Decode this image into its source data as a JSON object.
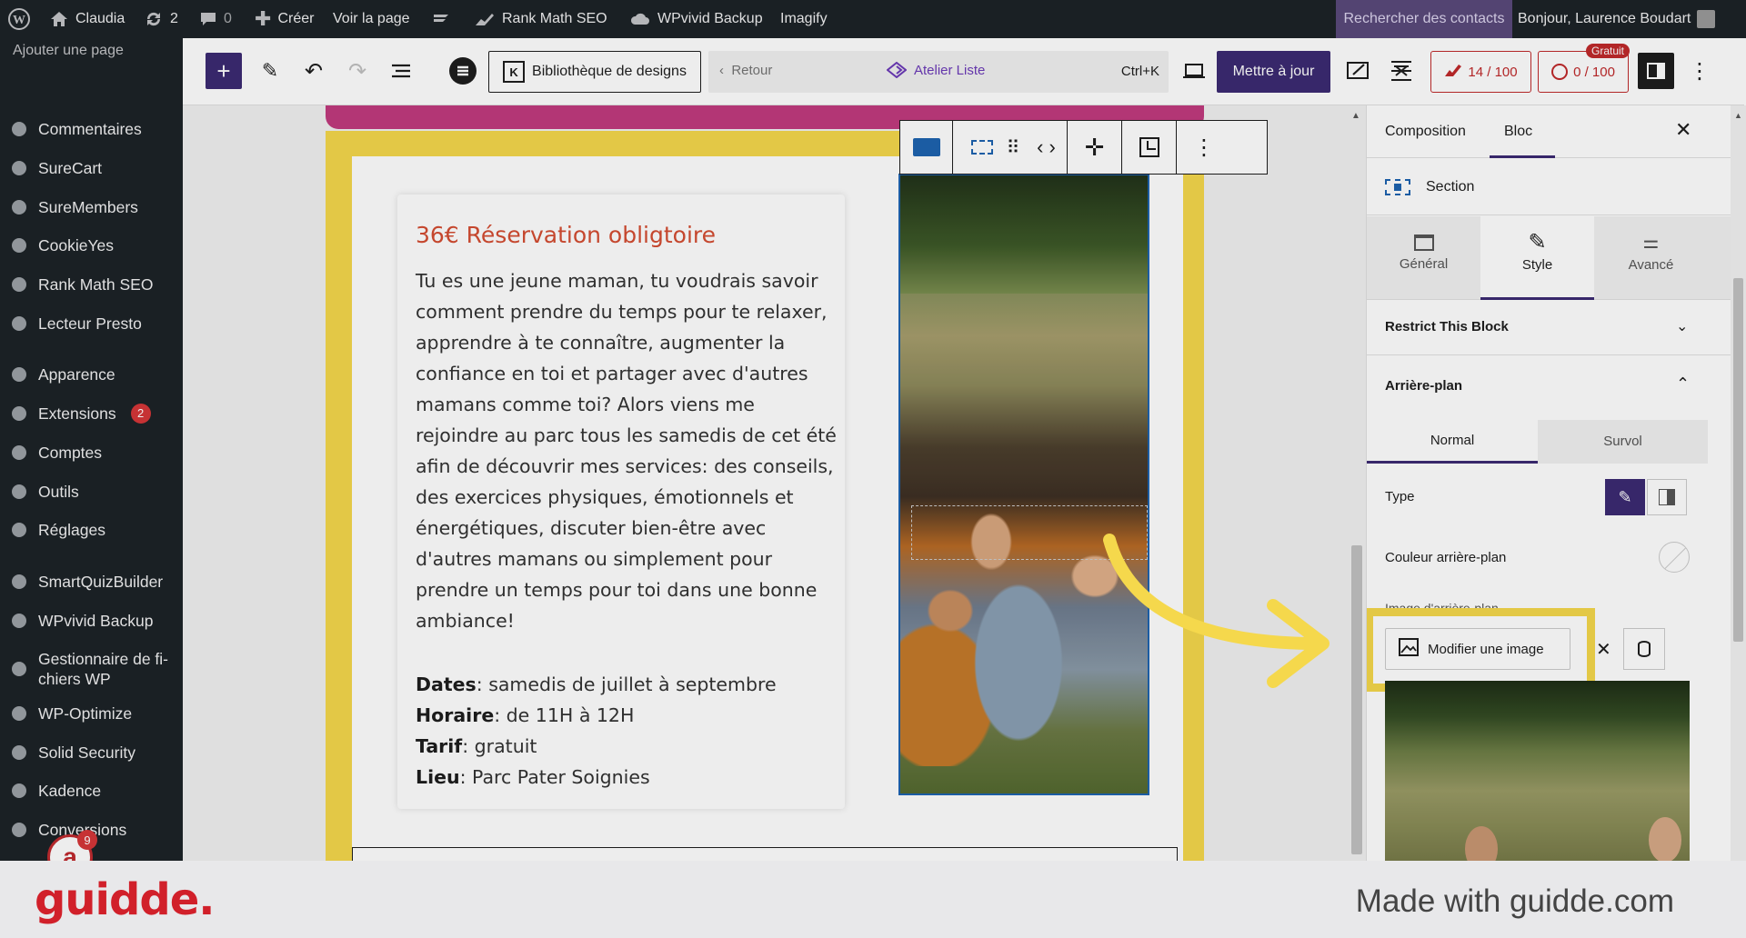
{
  "adminbar": {
    "site_name": "Claudia",
    "updates_count": "2",
    "comments_count": "0",
    "create_label": "Créer",
    "view_page_label": "Voir la page",
    "rankmath_label": "Rank Math SEO",
    "wpvivid_label": "WPvivid Backup",
    "imagify_label": "Imagify",
    "search_contacts_label": "Rechercher des contacts",
    "greeting": "Bonjour, Laurence Boudart"
  },
  "sidebar": {
    "add_page_label": "Ajouter une page",
    "items": [
      {
        "label": "Commentaires",
        "icon": "comment-icon"
      },
      {
        "label": "SureCart",
        "icon": "surecart-icon"
      },
      {
        "label": "SureMembers",
        "icon": "suremembers-icon"
      },
      {
        "label": "CookieYes",
        "icon": "cookie-icon"
      },
      {
        "label": "Rank Math SEO",
        "icon": "chart-icon"
      },
      {
        "label": "Lecteur Presto",
        "icon": "presto-icon"
      },
      {
        "label": "Apparence",
        "icon": "brush-icon"
      },
      {
        "label": "Extensions",
        "icon": "plugin-icon",
        "badge": "2"
      },
      {
        "label": "Comptes",
        "icon": "user-icon"
      },
      {
        "label": "Outils",
        "icon": "wrench-icon"
      },
      {
        "label": "Réglages",
        "icon": "settings-icon"
      },
      {
        "label": "SmartQuizBuilder",
        "icon": "gear-icon"
      },
      {
        "label": "WPvivid Backup",
        "icon": "cloud-icon"
      },
      {
        "label": "Gestionnaire de fi-\nchiers WP",
        "icon": "folder-icon"
      },
      {
        "label": "WP-Optimize",
        "icon": "optimize-icon"
      },
      {
        "label": "Solid Security",
        "icon": "shield-icon"
      },
      {
        "label": "Kadence",
        "icon": "kadence-icon"
      },
      {
        "label": "Conversions",
        "icon": "conversions-icon"
      }
    ],
    "notification_count": "9"
  },
  "toolbar": {
    "design_library_label": "Bibliothèque de designs",
    "back_label": "Retour",
    "document_title": "Atelier Liste",
    "shortcut": "Ctrl+K",
    "update_label": "Mettre à jour",
    "seo_score": "14 / 100",
    "readability_score": "0 / 100",
    "free_badge": "Gratuit"
  },
  "content": {
    "heading": "36€ Réservation obligtoire",
    "body": "Tu es une jeune maman, tu voudrais savoir comment prendre du temps pour te relaxer, apprendre à te connaître, augmenter la confiance en toi et partager avec d'autres mamans comme toi? Alors viens me rejoindre au parc tous les samedis de cet été afin de découvrir mes services: des conseils, des exercices physiques, émotionnels et énergétiques, discuter bien-être avec d'autres mamans ou simplement pour prendre un temps pour toi dans une bonne ambiance!",
    "details": [
      {
        "label": "Dates",
        "value": ": samedis de juillet à septembre"
      },
      {
        "label": "Horaire",
        "value": ": de 11H à 12H"
      },
      {
        "label": "Tarif",
        "value": ": gratuit"
      },
      {
        "label": "Lieu",
        "value": ": Parc Pater Soignies"
      }
    ]
  },
  "panel": {
    "tabs": [
      "Composition",
      "Bloc"
    ],
    "active_tab": "Bloc",
    "block_name": "Section",
    "subtabs": [
      "Général",
      "Style",
      "Avancé"
    ],
    "active_subtab": "Style",
    "restrict_label": "Restrict This Block",
    "background_label": "Arrière-plan",
    "state_tabs": [
      "Normal",
      "Survol"
    ],
    "type_label": "Type",
    "bg_color_label": "Couleur arrière-plan",
    "bg_image_label": "Image d'arrière-plan",
    "modify_image_label": "Modifier une image"
  },
  "footer": {
    "brand": "guidde.",
    "made_with": "Made with guidde.com"
  },
  "colors": {
    "admin_bg": "#1d2327",
    "accent": "#6c3bb8",
    "highlight": "#f5d84c",
    "footer_brand": "#d1202a"
  }
}
